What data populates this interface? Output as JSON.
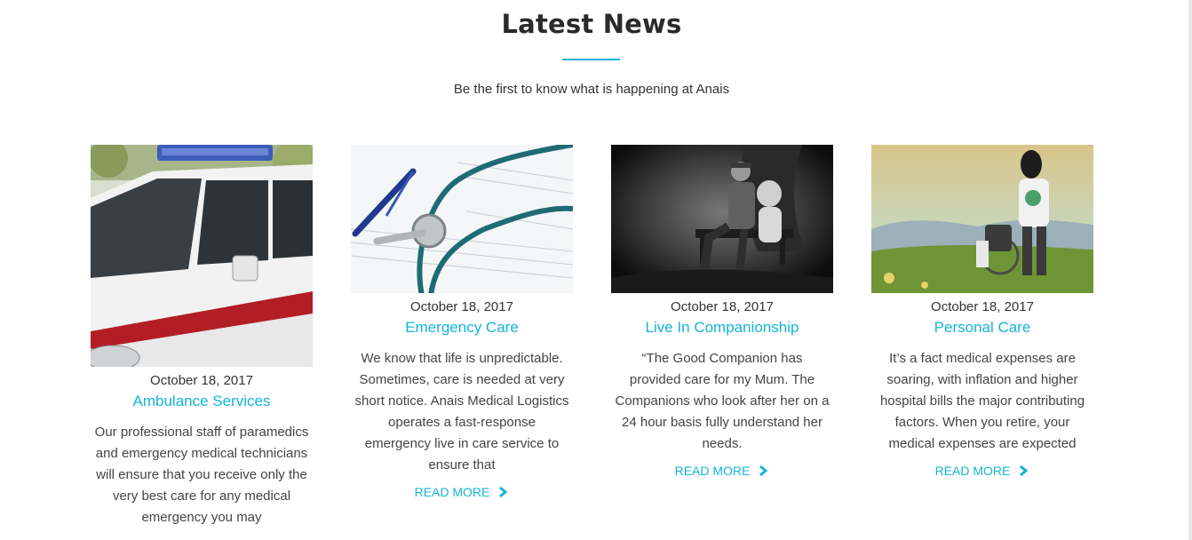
{
  "section": {
    "title": "Latest News",
    "subtitle": "Be the first to know what is happening at Anais"
  },
  "colors": {
    "accent": "#13b5d6",
    "text": "#333333",
    "heading": "#2a2a2a"
  },
  "posts": [
    {
      "date": "October 18, 2017",
      "title": "Ambulance Services",
      "excerpt": "Our professional staff of paramedics and emergency medical technicians will ensure that you receive only the very best care for any medical emergency you may",
      "image_icon": "ambulance-photo"
    },
    {
      "date": "October 18, 2017",
      "title": "Emergency Care",
      "excerpt": "We know that life is unpredictable. Sometimes, care is needed at very short notice. Anais Medical Logistics operates a fast-response emergency live in care service to ensure that",
      "read_more": "READ MORE",
      "image_icon": "stethoscope-photo"
    },
    {
      "date": "October 18, 2017",
      "title": "Live In Companionship",
      "excerpt": "“The Good Companion has provided care for my Mum. The Companions who look after her on a 24 hour basis fully understand her needs.",
      "read_more": "READ MORE",
      "image_icon": "elderly-couple-photo"
    },
    {
      "date": "October 18, 2017",
      "title": "Personal Care",
      "excerpt": "It’s a fact medical expenses are soaring, with inflation and higher hospital bills the major contributing factors. When you retire, your medical expenses are expected",
      "read_more": "READ MORE",
      "image_icon": "wheelchair-caregiver-photo"
    }
  ]
}
